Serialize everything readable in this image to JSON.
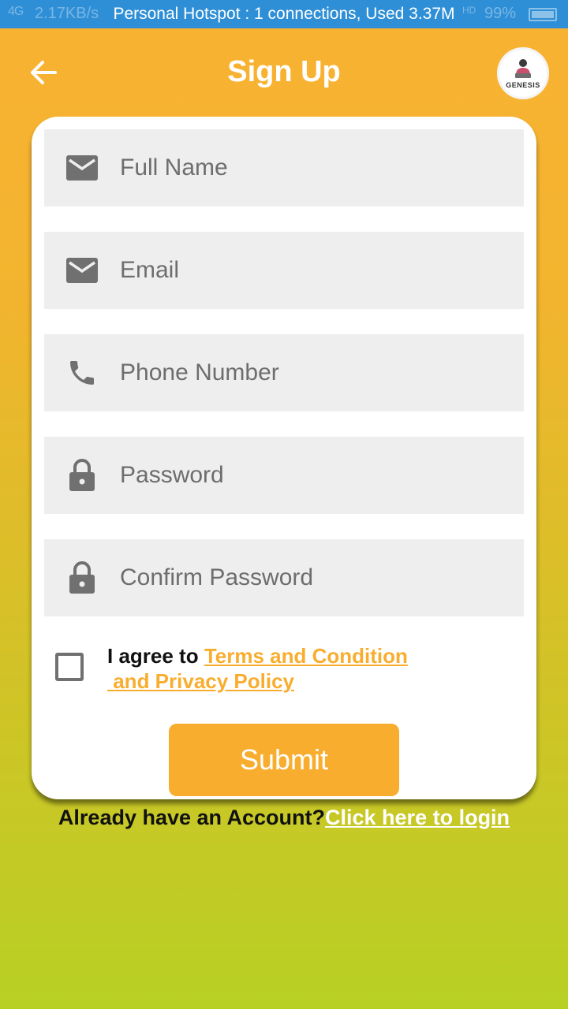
{
  "status_bar": {
    "signal": "4G",
    "speed": "2.17KB/s",
    "hotspot": "Personal Hotspot : 1 connections, Used 3.37M",
    "hd": "HD",
    "battery": "99%"
  },
  "header": {
    "title": "Sign Up",
    "back_icon": "arrow-left-icon",
    "logo_text": "GENESIS"
  },
  "form": {
    "full_name": {
      "placeholder": "Full Name",
      "value": "",
      "icon": "mail-icon"
    },
    "email": {
      "placeholder": "Email",
      "value": "",
      "icon": "mail-icon"
    },
    "phone": {
      "placeholder": "Phone Number",
      "value": "",
      "icon": "phone-icon"
    },
    "password": {
      "placeholder": "Password",
      "value": "",
      "icon": "lock-icon"
    },
    "confirm_password": {
      "placeholder": "Confirm Password",
      "value": "",
      "icon": "lock-icon"
    },
    "agree": {
      "prefix": "I agree to ",
      "link_line1": "Terms and Condition",
      "link_line2": " and Privacy Policy",
      "checked": false
    },
    "submit_label": "Submit"
  },
  "footer": {
    "prompt": "Already have an Account?",
    "login_link": "Click here to login"
  },
  "colors": {
    "accent": "#f9ad2f",
    "status_bar": "#2f8fd6",
    "field_bg": "#eeeeee",
    "icon": "#707070"
  }
}
